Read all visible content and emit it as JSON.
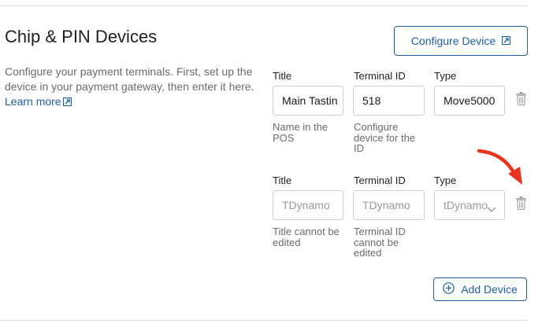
{
  "section": {
    "title": "Chip & PIN Devices",
    "description": "Configure your payment terminals. First, set up the device in your payment gateway, then enter it here.",
    "learn_more": "Learn more"
  },
  "configure_button": {
    "label": "Configure Device"
  },
  "devices": [
    {
      "title_label": "Title",
      "terminal_label": "Terminal ID",
      "type_label": "Type",
      "title_value": "Main Tastin",
      "terminal_value": "518",
      "type_value": "Move5000",
      "title_help": "Name in the POS",
      "terminal_help": "Configure device for the ID"
    },
    {
      "title_label": "Title",
      "terminal_label": "Terminal ID",
      "type_label": "Type",
      "title_value": "TDynamo",
      "terminal_value": "TDynamo",
      "type_value": "tDynamo",
      "title_help": "Title cannot be edited",
      "terminal_help": "Terminal ID cannot be edited"
    }
  ],
  "add_button": {
    "label": "Add Device"
  },
  "colors": {
    "accent": "#1c5fa0",
    "annotation_arrow": "#e8331f"
  }
}
